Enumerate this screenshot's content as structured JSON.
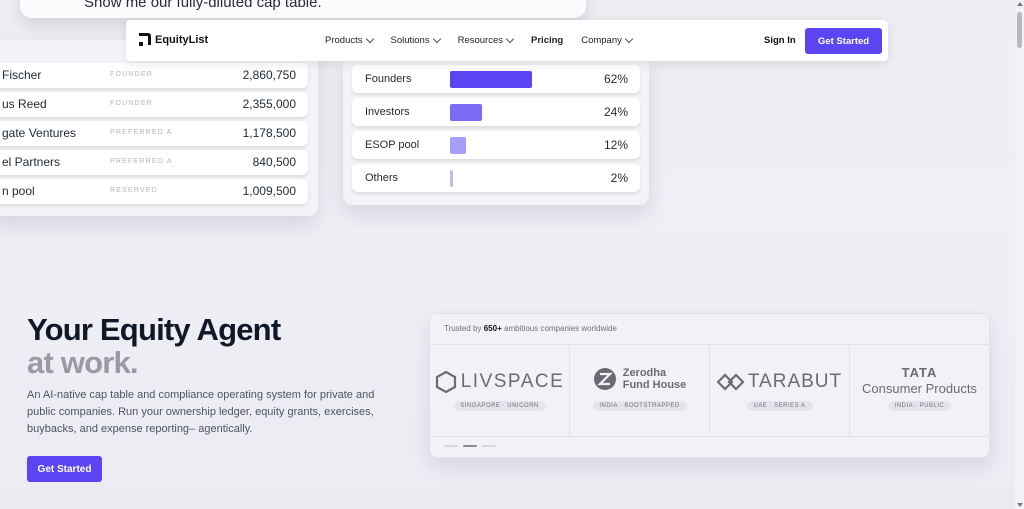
{
  "top_card": {
    "text": "Show me our fully-diluted cap table."
  },
  "holdings": [
    {
      "name": "Fischer",
      "class": "FOUNDER",
      "value": "2,860,750"
    },
    {
      "name": "us Reed",
      "class": "FOUNDER",
      "value": "2,355,000"
    },
    {
      "name": "gate Ventures",
      "class": "PREFERRED A",
      "value": "1,178,500"
    },
    {
      "name": "el Partners",
      "class": "PREFERRED A",
      "value": "840,500"
    },
    {
      "name": "n pool",
      "class": "RESERVED",
      "value": "1,009,500"
    }
  ],
  "ownership": [
    {
      "label": "Founders",
      "pct": "62%",
      "fraction": 0.62,
      "color": "#5b45f2"
    },
    {
      "label": "Investors",
      "pct": "24%",
      "fraction": 0.24,
      "color": "#7c6af5"
    },
    {
      "label": "ESOP pool",
      "pct": "12%",
      "fraction": 0.12,
      "color": "#a89df7"
    },
    {
      "label": "Others",
      "pct": "2%",
      "fraction": 0.02,
      "color": "#c4bcf8"
    }
  ],
  "nav": {
    "brand": "EquityList",
    "menu": [
      {
        "label": "Products",
        "dropdown": true
      },
      {
        "label": "Solutions",
        "dropdown": true
      },
      {
        "label": "Resources",
        "dropdown": true
      },
      {
        "label": "Pricing",
        "dropdown": false
      },
      {
        "label": "Company",
        "dropdown": true
      }
    ],
    "sign_in": "Sign In",
    "cta": "Get Started"
  },
  "hero": {
    "title_line1": "Your Equity Agent",
    "title_line2": "at work.",
    "description": "An AI-native cap table and compliance operating system for private and public companies. Run your ownership ledger, equity grants, exercises, buybacks, and expense reporting– agentically.",
    "cta": "Get Started"
  },
  "trusted": {
    "prefix": "Trusted by",
    "count": "650+",
    "suffix": "ambitious companies worldwide",
    "logos": [
      {
        "name": "LIVSPACE",
        "badge": "SINGAPORE · UNICORN"
      },
      {
        "name_line1": "Zerodha",
        "name_line2": "Fund House",
        "badge": "INDIA · BOOTSTRAPPED"
      },
      {
        "name": "TARABUT",
        "badge": "UAE · SERIES A"
      },
      {
        "name_line1": "TATA",
        "name_line2": "Consumer Products",
        "badge": "INDIA · PUBLIC"
      }
    ]
  }
}
